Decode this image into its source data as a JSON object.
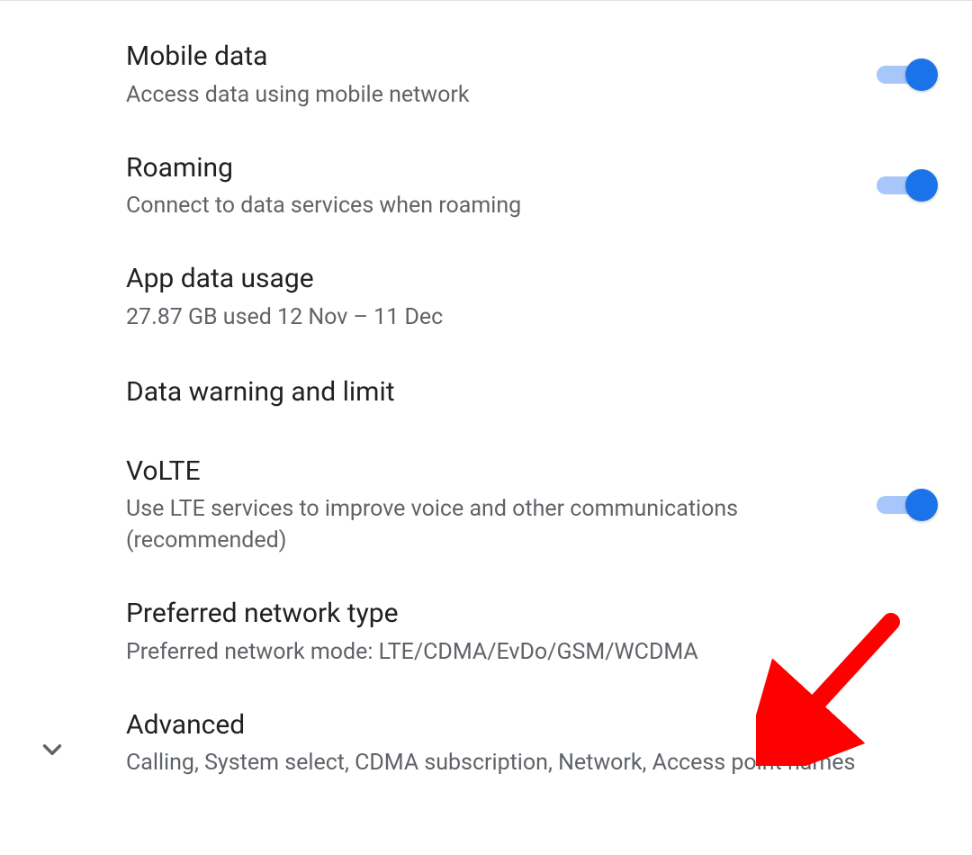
{
  "settings": [
    {
      "id": "mobile-data",
      "title": "Mobile data",
      "subtitle": "Access data using mobile network",
      "toggle": true,
      "toggle_on": true
    },
    {
      "id": "roaming",
      "title": "Roaming",
      "subtitle": "Connect to data services when roaming",
      "toggle": true,
      "toggle_on": true
    },
    {
      "id": "app-data-usage",
      "title": "App data usage",
      "subtitle": "27.87 GB used 12 Nov – 11 Dec",
      "toggle": false
    },
    {
      "id": "data-warning-limit",
      "title": "Data warning and limit",
      "subtitle": "",
      "toggle": false
    },
    {
      "id": "volte",
      "title": "VoLTE",
      "subtitle": "Use LTE services to improve voice and other communications (recommended)",
      "toggle": true,
      "toggle_on": true
    },
    {
      "id": "preferred-network-type",
      "title": "Preferred network type",
      "subtitle": "Preferred network mode: LTE/CDMA/EvDo/GSM/WCDMA",
      "toggle": false
    },
    {
      "id": "advanced",
      "title": "Advanced",
      "subtitle": "Calling, System select, CDMA subscription, Network, Access point names",
      "toggle": false,
      "expand_icon": true
    }
  ],
  "annotation": {
    "type": "arrow",
    "color": "#ff0000",
    "target": "advanced"
  }
}
